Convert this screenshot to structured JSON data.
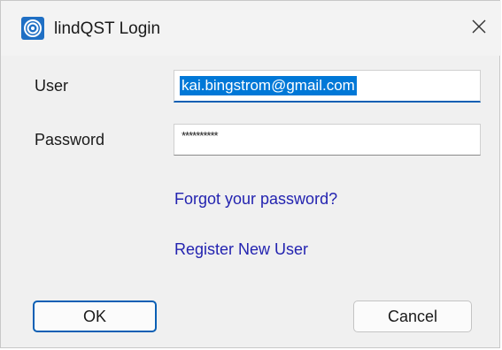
{
  "window": {
    "title": "lindQST Login",
    "icon": "app-logo-icon",
    "close_icon": "close-icon",
    "accent_color": "#0a5fb4",
    "link_color": "#2323b0"
  },
  "form": {
    "user_label": "User",
    "user_value": "kai.bingstrom@gmail.com",
    "password_label": "Password",
    "password_mask": "**********"
  },
  "links": {
    "forgot_password": "Forgot your password?",
    "register": "Register New User"
  },
  "buttons": {
    "ok": "OK",
    "cancel": "Cancel"
  }
}
